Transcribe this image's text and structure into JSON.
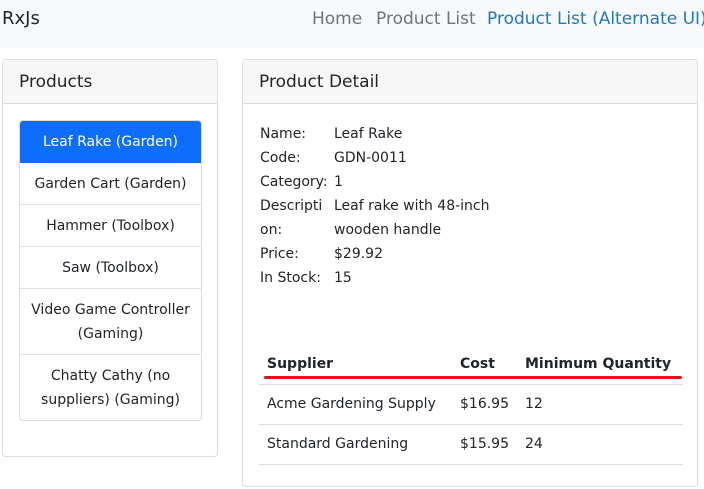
{
  "navbar": {
    "brand": "RxJs",
    "links": [
      "Home",
      "Product List",
      "Product List (Alternate UI)"
    ]
  },
  "products_panel": {
    "title": "Products",
    "items": [
      "Leaf Rake (Garden)",
      "Garden Cart (Garden)",
      "Hammer (Toolbox)",
      "Saw (Toolbox)",
      "Video Game Controller (Gaming)",
      "Chatty Cathy (no suppliers) (Gaming)"
    ],
    "selected_index": 0
  },
  "detail_panel": {
    "title": "Product Detail",
    "fields": [
      {
        "label": "Name:",
        "value": "Leaf Rake"
      },
      {
        "label": "Code:",
        "value": "GDN-0011"
      },
      {
        "label": "Category:",
        "value": "1"
      },
      {
        "label": "Description:",
        "value": "Leaf rake with 48-inch wooden handle"
      },
      {
        "label": "Price:",
        "value": "$29.92"
      },
      {
        "label": "In Stock:",
        "value": "15"
      }
    ],
    "suppliers": {
      "headers": [
        "Supplier",
        "Cost",
        "Minimum Quantity"
      ],
      "rows": [
        [
          "Acme Gardening Supply",
          "$16.95",
          "12"
        ],
        [
          "Standard Gardening",
          "$15.95",
          "24"
        ]
      ]
    }
  },
  "colors": {
    "active_item": "#0d6efd",
    "alt_link": "#1f7bb8",
    "underline": "#e8101a"
  }
}
